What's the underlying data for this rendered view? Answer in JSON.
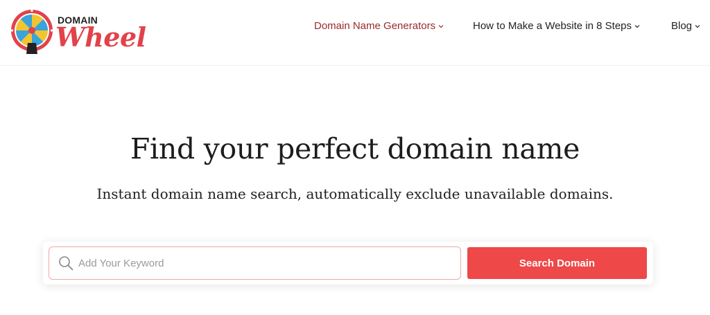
{
  "logo": {
    "top_text": "DOMAIN",
    "main_text": "Wheel"
  },
  "nav": {
    "items": [
      {
        "label": "Domain Name Generators",
        "active": true
      },
      {
        "label": "How to Make a Website in 8 Steps",
        "active": false
      },
      {
        "label": "Blog",
        "active": false
      }
    ]
  },
  "hero": {
    "title": "Find your perfect domain name",
    "subtitle": "Instant domain name search, automatically exclude unavailable domains."
  },
  "search": {
    "placeholder": "Add Your Keyword",
    "value": "",
    "button_label": "Search Domain",
    "icon": "search-icon"
  },
  "colors": {
    "accent": "#ee4848",
    "nav_active": "#9a2b2b",
    "logo_red": "#e2424a"
  }
}
